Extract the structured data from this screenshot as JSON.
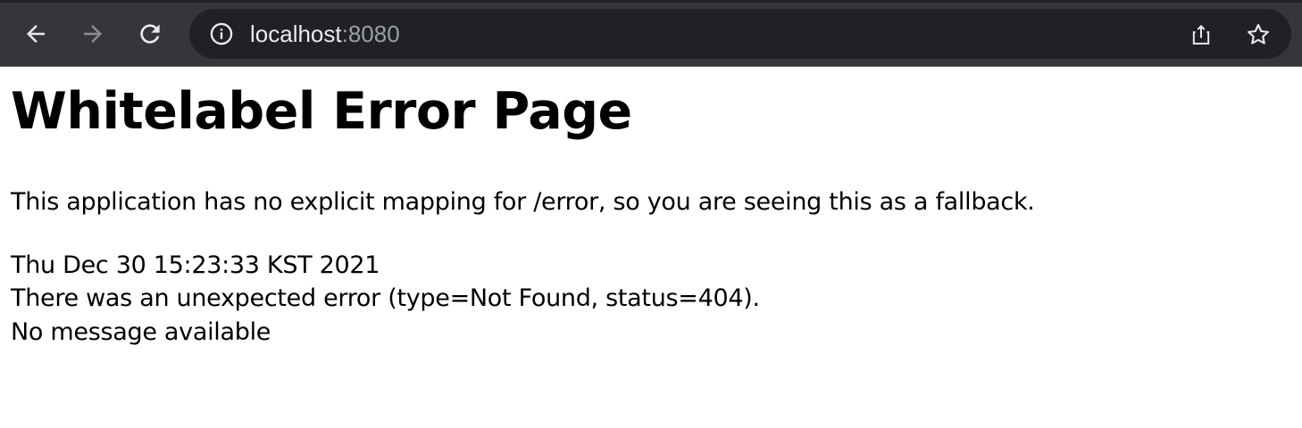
{
  "browser": {
    "url_host": "localhost",
    "url_port": ":8080",
    "icons": {
      "back": "arrow-left-icon",
      "forward": "arrow-right-icon",
      "reload": "reload-icon",
      "site_info": "info-icon",
      "share": "share-icon",
      "bookmark": "star-icon"
    },
    "colors": {
      "toolbar": "#35363a",
      "omnibox": "#202124",
      "text_primary": "#e8eaed",
      "text_secondary": "#9aa0a6"
    }
  },
  "page": {
    "title": "Whitelabel Error Page",
    "description": "This application has no explicit mapping for /error, so you are seeing this as a fallback.",
    "timestamp": "Thu Dec 30 15:23:33 KST 2021",
    "error_summary": "There was an unexpected error (type=Not Found, status=404).",
    "message": "No message available"
  }
}
